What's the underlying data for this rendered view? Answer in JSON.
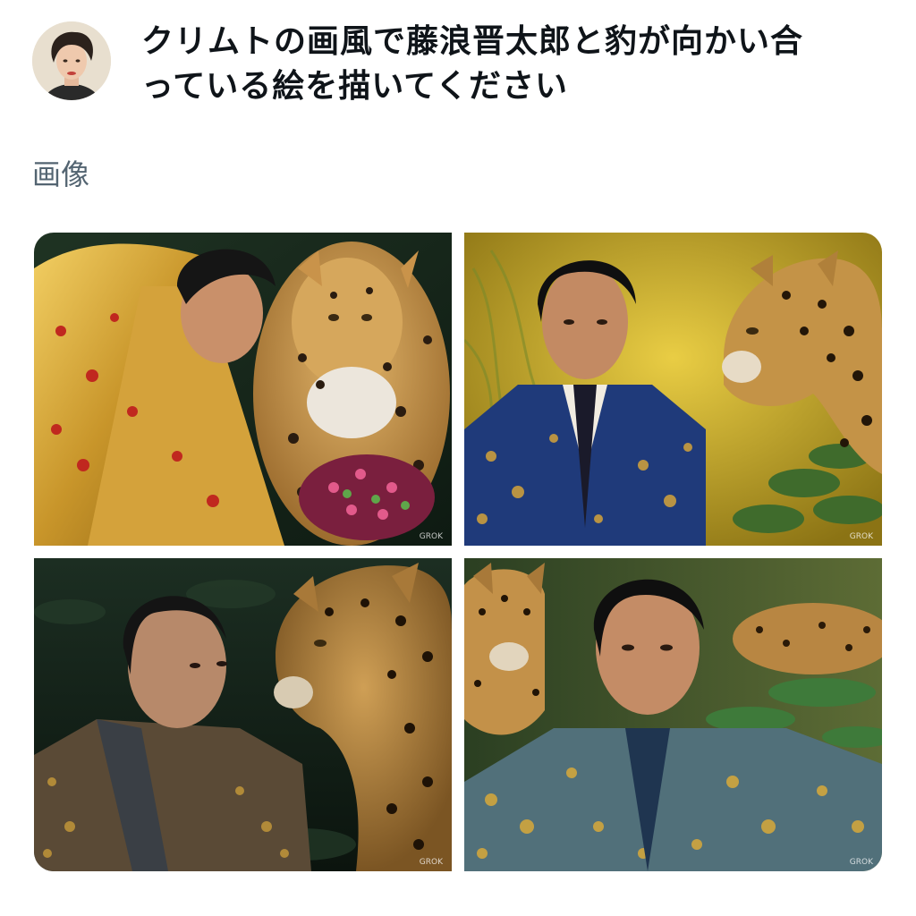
{
  "post": {
    "prompt_line1": "クリムトの画風で藤浪晋太郎と豹が向かい合",
    "prompt_line2": "っている絵を描いてください",
    "section_label": "画像"
  },
  "images": [
    {
      "watermark": "GROK"
    },
    {
      "watermark": "GROK"
    },
    {
      "watermark": "GROK"
    },
    {
      "watermark": "GROK"
    }
  ],
  "colors": {
    "text_primary": "#0f1419",
    "text_secondary": "#536471",
    "background": "#ffffff"
  }
}
